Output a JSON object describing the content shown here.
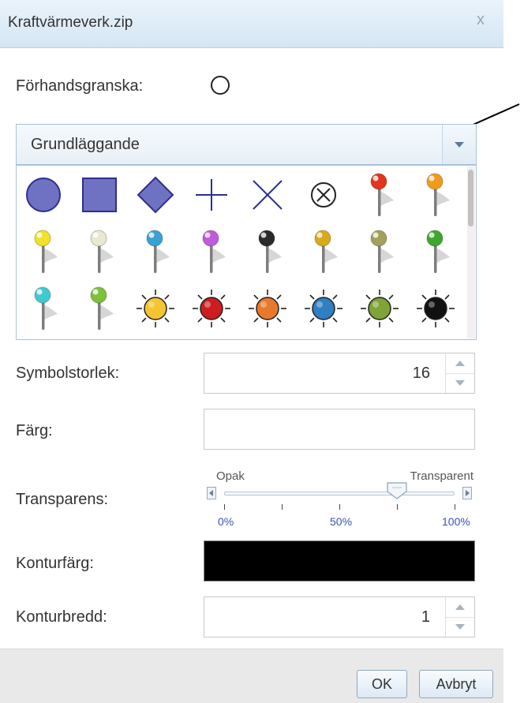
{
  "dialog": {
    "title": "Kraftvärmeverk.zip",
    "close_glyph": "x"
  },
  "preview": {
    "label": "Förhandsgranska:",
    "symbol": "circle-outline"
  },
  "symbol_category": {
    "selected": "Grundläggande"
  },
  "symbols": [
    "circle-filled",
    "square-filled",
    "diamond-filled",
    "cross",
    "x-mark",
    "circled-x",
    "pushpin-red",
    "pushpin-orange",
    "pushpin-yellow",
    "pushpin-white",
    "pushpin-blue",
    "pushpin-purple",
    "pushpin-black",
    "pushpin-gold",
    "pushpin-olive",
    "pushpin-green",
    "pushpin-cyan",
    "pushpin-lime",
    "sun-yellow",
    "sun-red",
    "sun-orange",
    "sun-blue",
    "sun-green",
    "sun-black"
  ],
  "symbol_size": {
    "label": "Symbolstorlek:",
    "value": "16"
  },
  "color": {
    "label": "Färg:",
    "value": "#ffffff"
  },
  "transparency": {
    "label": "Transparens:",
    "min_label": "Opak",
    "max_label": "Transparent",
    "tick_labels": [
      "0%",
      "50%",
      "100%"
    ],
    "value": 0.75
  },
  "outline_color": {
    "label": "Konturfärg:",
    "value": "#000000"
  },
  "outline_width": {
    "label": "Konturbredd:",
    "value": "1"
  },
  "buttons": {
    "ok": "OK",
    "cancel": "Avbryt"
  },
  "colors": {
    "symbol_fill": "#6f72c2",
    "symbol_stroke": "#2b2f8f",
    "pin_red": "#e2361c",
    "pin_orange": "#f39a1c",
    "pin_yellow": "#f2e02a",
    "pin_white": "#e9e9cf",
    "pin_blue": "#3aa0d8",
    "pin_purple": "#c15adc",
    "pin_black": "#2a2a2a",
    "pin_gold": "#d9a91c",
    "pin_olive": "#a4a05a",
    "pin_green": "#3fa72f",
    "pin_cyan": "#41c9d3",
    "pin_lime": "#7ec03a",
    "sun_yellow": "#f4c531",
    "sun_red": "#cc1e1e",
    "sun_orange": "#e8792a",
    "sun_blue": "#2f7fc2",
    "sun_green": "#7fa336",
    "sun_black": "#111111",
    "tick_label": "#3b50b7"
  }
}
